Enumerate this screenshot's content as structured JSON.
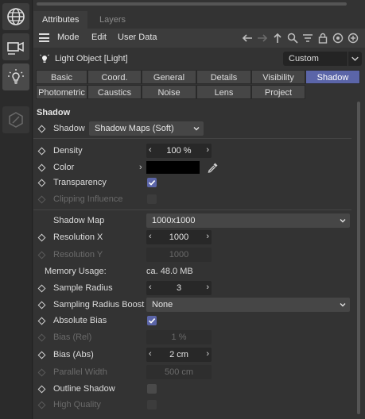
{
  "tabs": {
    "attributes": "Attributes",
    "layers": "Layers"
  },
  "menubar": {
    "mode": "Mode",
    "edit": "Edit",
    "user_data": "User Data"
  },
  "object": {
    "title": "Light Object [Light]",
    "preset": "Custom"
  },
  "categories": {
    "basic": "Basic",
    "coord": "Coord.",
    "general": "General",
    "details": "Details",
    "visibility": "Visibility",
    "shadow": "Shadow",
    "photometric": "Photometric",
    "caustics": "Caustics",
    "noise": "Noise",
    "lens": "Lens",
    "project": "Project"
  },
  "section_title": "Shadow",
  "shadow": {
    "label": "Shadow",
    "value": "Shadow Maps (Soft)"
  },
  "density": {
    "label": "Density",
    "value": "100 %"
  },
  "color": {
    "label": "Color",
    "value": "#000000"
  },
  "transparency": {
    "label": "Transparency",
    "checked": true
  },
  "clipping_influence": {
    "label": "Clipping Influence",
    "checked": false
  },
  "shadow_map": {
    "label": "Shadow Map",
    "value": "1000x1000"
  },
  "resolution_x": {
    "label": "Resolution X",
    "value": "1000"
  },
  "resolution_y": {
    "label": "Resolution Y",
    "value": "1000"
  },
  "memory_usage": {
    "label": "Memory Usage:",
    "value": "ca. 48.0 MB"
  },
  "sample_radius": {
    "label": "Sample Radius",
    "value": "3"
  },
  "sampling_radius_boost": {
    "label": "Sampling Radius Boost",
    "value": "None"
  },
  "absolute_bias": {
    "label": "Absolute Bias",
    "checked": true
  },
  "bias_rel": {
    "label": "Bias (Rel)",
    "value": "1 %"
  },
  "bias_abs": {
    "label": "Bias (Abs)",
    "value": "2 cm"
  },
  "parallel_width": {
    "label": "Parallel Width",
    "value": "500 cm"
  },
  "outline_shadow": {
    "label": "Outline Shadow",
    "checked": false
  },
  "high_quality": {
    "label": "High Quality",
    "checked": false
  },
  "colors": {
    "accent": "#5b65a8",
    "panel": "#333333",
    "field": "#282828"
  },
  "icons": [
    "globe-icon",
    "camera-icon",
    "light-bulb-icon",
    "disabled-tool-icon",
    "back-arrow-icon",
    "forward-arrow-icon",
    "up-arrow-icon",
    "search-icon",
    "filter-icon",
    "lock-icon",
    "target-icon",
    "add-icon",
    "eyedropper-icon"
  ]
}
